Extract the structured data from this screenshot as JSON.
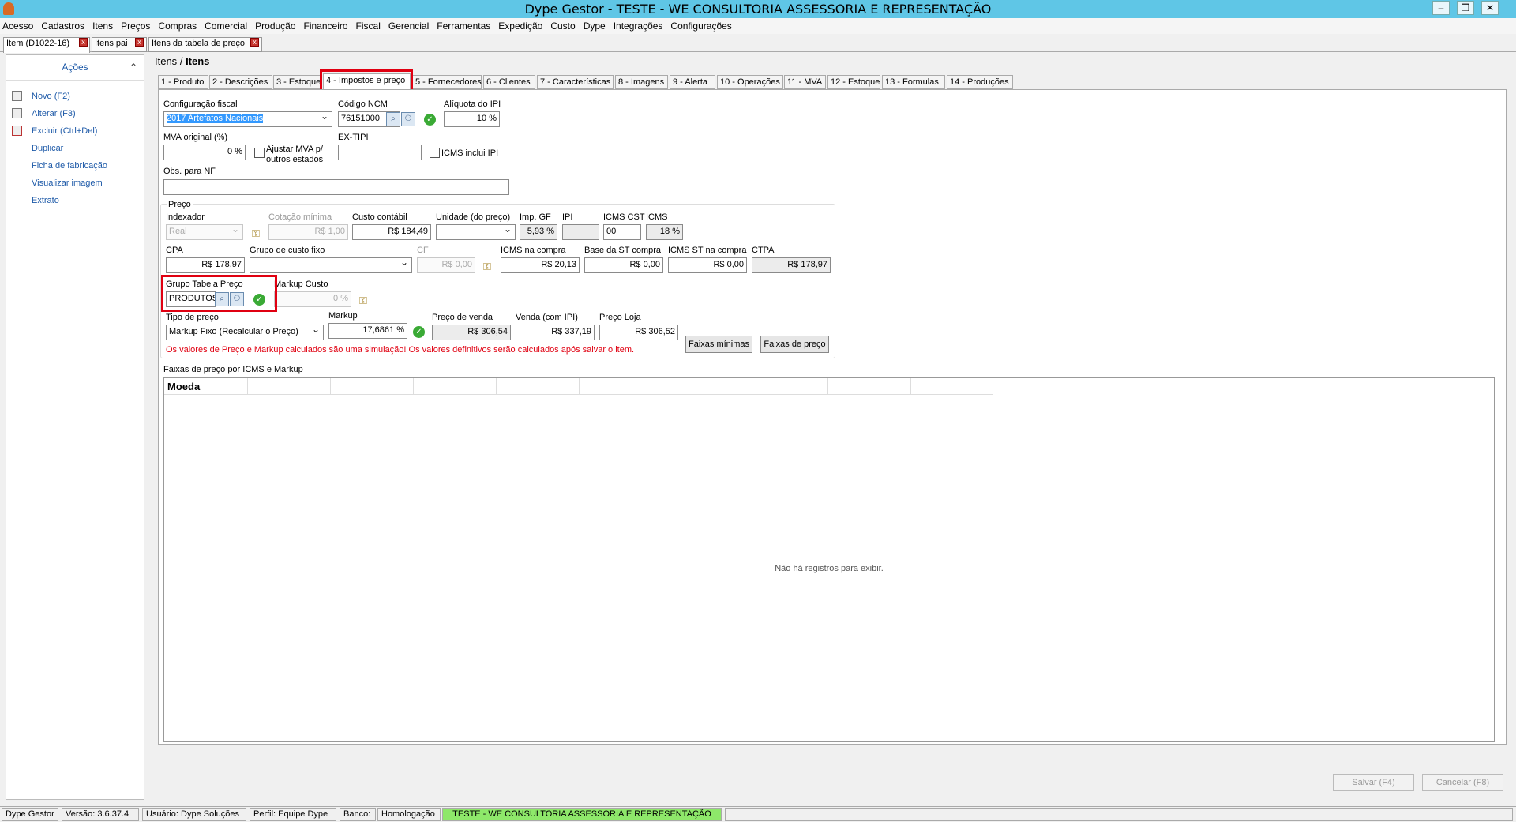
{
  "window": {
    "title": "Dype Gestor - TESTE - WE CONSULTORIA ASSESSORIA E REPRESENTAÇÃO"
  },
  "menu": [
    "Acesso",
    "Cadastros",
    "Itens",
    "Preços",
    "Compras",
    "Comercial",
    "Produção",
    "Financeiro",
    "Fiscal",
    "Gerencial",
    "Ferramentas",
    "Expedição",
    "Custo",
    "Dype",
    "Integrações",
    "Configurações"
  ],
  "doc_tabs": [
    "Item (D1022-16)",
    "Itens pai",
    "Itens da tabela de preço"
  ],
  "sidebar": {
    "header": "Ações",
    "items": [
      "Novo (F2)",
      "Alterar (F3)",
      "Excluir (Ctrl+Del)",
      "Duplicar",
      "Ficha de fabricação",
      "Visualizar imagem",
      "Extrato"
    ]
  },
  "breadcrumb": {
    "link": "Itens",
    "sep": "/",
    "current": "Itens"
  },
  "tabs": [
    "1 - Produto",
    "2 - Descrições",
    "3 - Estoque",
    "4 - Impostos e preço",
    "5 - Fornecedores",
    "6 - Clientes",
    "7 - Características",
    "8 - Imagens",
    "9 - Alerta",
    "10 - Operações",
    "11 - MVA",
    "12 - Estoque",
    "13 - Formulas",
    "14 - Produções"
  ],
  "fiscal": {
    "config_label": "Configuração fiscal",
    "config_value": "2017 Artefatos Nacionais",
    "ncm_label": "Código NCM",
    "ncm_value": "76151000",
    "ipi_label": "Alíquota do IPI",
    "ipi_value": "10 %",
    "mva_label": "MVA original (%)",
    "mva_value": "0 %",
    "ajustar_label_1": "Ajustar MVA p/",
    "ajustar_label_2": "outros estados",
    "extipi_label": "EX-TIPI",
    "extipi_value": "",
    "icms_ipi_label": "ICMS inclui IPI",
    "obs_label": "Obs. para NF",
    "obs_value": ""
  },
  "preco": {
    "group_label": "Preço",
    "indexador_label": "Indexador",
    "indexador_value": "Real",
    "cotacao_label": "Cotação mínima",
    "cotacao_value": "R$ 1,00",
    "custo_label": "Custo contábil",
    "custo_value": "R$ 184,49",
    "unidade_label": "Unidade (do preço)",
    "unidade_value": "",
    "impgf_label": "Imp. GF",
    "impgf_value": "5,93 %",
    "ipi_label": "IPI",
    "ipi_value": "",
    "icmscst_label": "ICMS CST",
    "icmscst_value": "00",
    "icms_label": "ICMS",
    "icms_value": "18 %",
    "cpa_label": "CPA",
    "cpa_value": "R$ 178,97",
    "grupofixo_label": "Grupo de custo fixo",
    "grupofixo_value": "",
    "cf_label": "CF",
    "cf_value": "R$ 0,00",
    "icmscompra_label": "ICMS na compra",
    "icmscompra_value": "R$ 20,13",
    "basest_label": "Base da ST compra",
    "basest_value": "R$ 0,00",
    "icmsst_label": "ICMS ST na compra",
    "icmsst_value": "R$ 0,00",
    "ctpa_label": "CTPA",
    "ctpa_value": "R$ 178,97",
    "grupotab_label": "Grupo Tabela Preço",
    "grupotab_value": "PRODUTOS I",
    "markupcusto_label": "Markup Custo",
    "markupcusto_value": "0 %",
    "tipo_label": "Tipo de preço",
    "tipo_value": "Markup Fixo (Recalcular o Preço)",
    "markup_label": "Markup",
    "markup_value": "17,6861 %",
    "venda_label": "Preço de venda",
    "venda_value": "R$ 306,54",
    "vendaipi_label": "Venda (com IPI)",
    "vendaipi_value": "R$ 337,19",
    "loja_label": "Preço Loja",
    "loja_value": "R$ 306,52",
    "btn_faixas_min": "Faixas mínimas",
    "btn_faixas": "Faixas de preço",
    "warning": "Os valores de Preço e Markup calculados são uma simulação! Os valores definitivos serão calculados após salvar o item."
  },
  "faixas": {
    "title": "Faixas de preço por ICMS e Markup",
    "col_moeda": "Moeda",
    "empty": "Não há registros para exibir."
  },
  "footer": {
    "save": "Salvar (F4)",
    "cancel": "Cancelar (F8)"
  },
  "status": {
    "app": "Dype Gestor",
    "versao": "Versão: 3.6.37.4",
    "usuario": "Usuário: Dype Soluções",
    "perfil": "Perfil: Equipe Dype",
    "banco": "Banco:",
    "banco_val": "Homologação",
    "empresa": "TESTE - WE CONSULTORIA ASSESSORIA E REPRESENTAÇÃO"
  },
  "colors": {
    "titlebar": "#5fc6e6",
    "link": "#1e5aa8",
    "highlight": "#e00011",
    "status_green": "#8ee86a"
  }
}
